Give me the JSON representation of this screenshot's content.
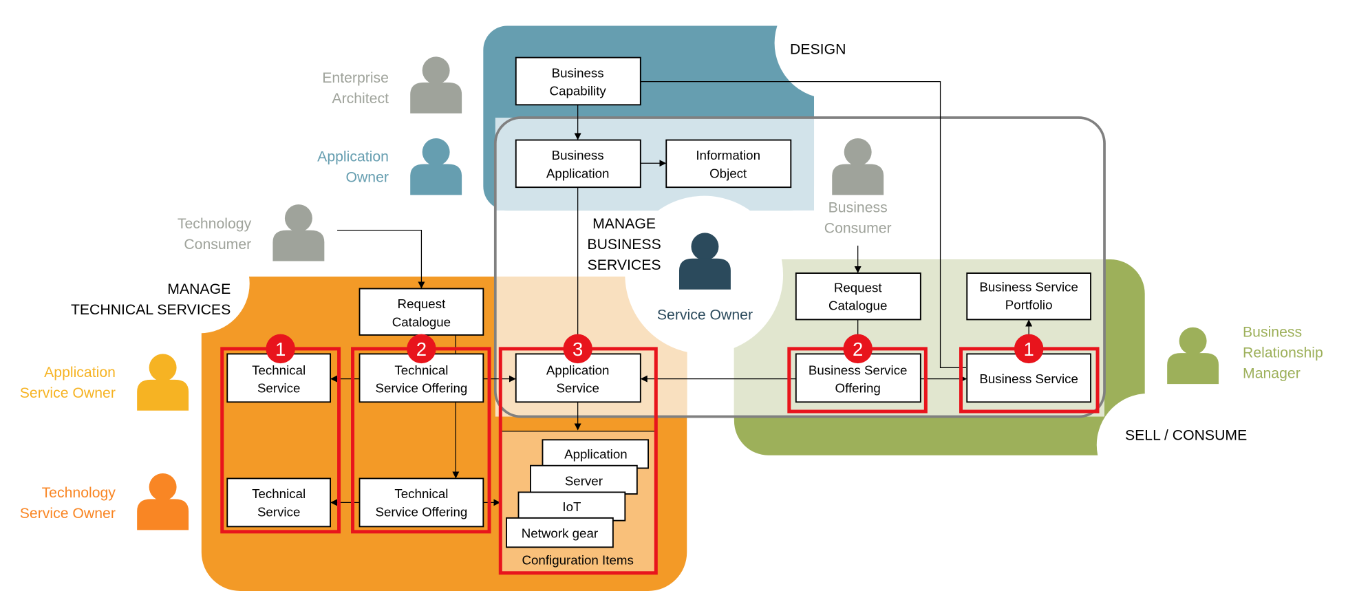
{
  "regions": {
    "design": "DESIGN",
    "manage_business": [
      "MANAGE",
      "BUSINESS",
      "SERVICES"
    ],
    "manage_technical": [
      "MANAGE",
      "TECHNICAL SERVICES"
    ],
    "sell_consume": "SELL / CONSUME"
  },
  "roles": {
    "enterprise_architect": [
      "Enterprise",
      "Architect"
    ],
    "application_owner": [
      "Application",
      "Owner"
    ],
    "technology_consumer": [
      "Technology",
      "Consumer"
    ],
    "business_consumer": [
      "Business",
      "Consumer"
    ],
    "service_owner": "Service Owner",
    "business_relationship_manager": [
      "Business",
      "Relationship",
      "Manager"
    ],
    "application_service_owner": [
      "Application",
      "Service Owner"
    ],
    "technology_service_owner": [
      "Technology",
      "Service Owner"
    ]
  },
  "boxes": {
    "business_capability": [
      "Business",
      "Capability"
    ],
    "business_application": [
      "Business",
      "Application"
    ],
    "information_object": [
      "Information",
      "Object"
    ],
    "request_catalogue_tech": [
      "Request",
      "Catalogue"
    ],
    "technical_service_1": [
      "Technical",
      "Service"
    ],
    "technical_service_2": [
      "Technical",
      "Service"
    ],
    "technical_service_offering_1": [
      "Technical",
      "Service Offering"
    ],
    "technical_service_offering_2": [
      "Technical",
      "Service Offering"
    ],
    "application_service": [
      "Application",
      "Service"
    ],
    "request_catalogue_business": [
      "Request",
      "Catalogue"
    ],
    "business_service_portfolio": [
      "Business Service",
      "Portfolio"
    ],
    "business_service_offering": [
      "Business Service",
      "Offering"
    ],
    "business_service": "Business Service"
  },
  "configuration_items": {
    "title": "Configuration Items",
    "items": [
      "Application",
      "Server",
      "IoT",
      "Network gear"
    ]
  },
  "badges": [
    "1",
    "2",
    "3",
    "2",
    "1"
  ],
  "colors": {
    "design": "#669eb0",
    "design_light": "#d2e3ea",
    "technical": "#f39a27",
    "technical_light": "#f9e0bf",
    "ci": "#f9c07a",
    "sell": "#9db05a",
    "sell_light": "#e1e6cf",
    "highlight": "#e8141c",
    "service_owner": "#2b4a5c",
    "gray_role": "#9fa39b",
    "app_service_owner": "#f6b323",
    "tech_service_owner": "#f98624"
  }
}
